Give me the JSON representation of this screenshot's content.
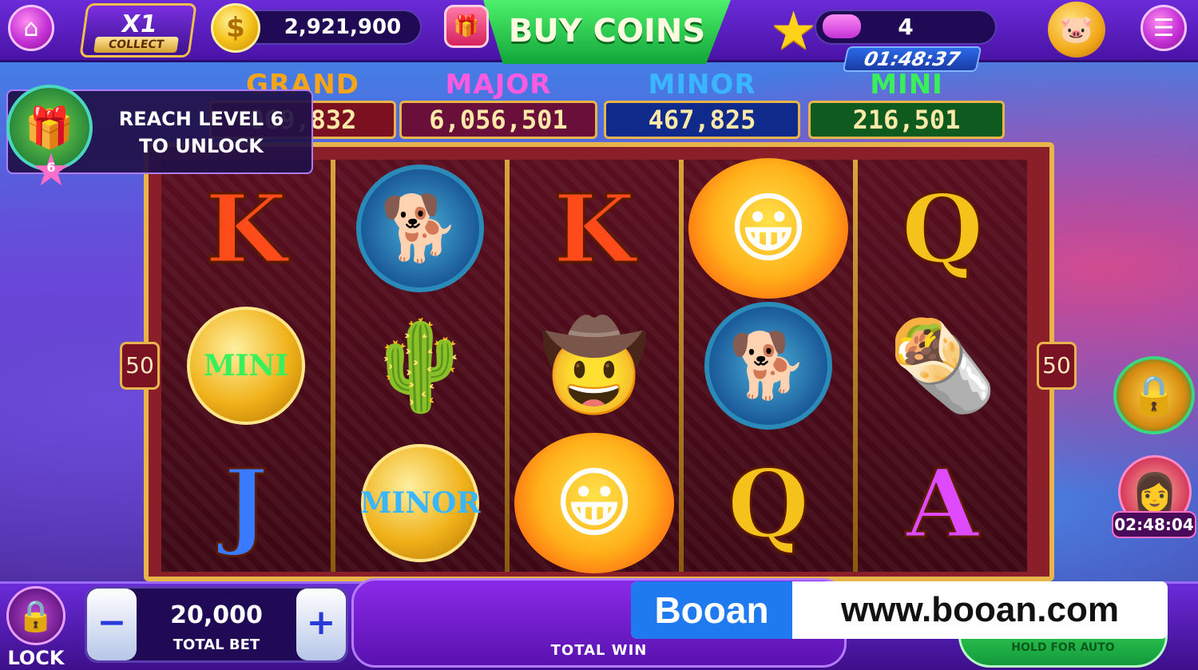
{
  "top_bar": {
    "home_icon": "home-icon",
    "collect": {
      "multiplier": "X1",
      "label": "COLLECT"
    },
    "balance": "2,921,900",
    "buy_coins_label": "BUY COINS",
    "level": "4",
    "level_timer": "01:48:37",
    "menu_icon": "menu-icon"
  },
  "jackpots": [
    {
      "title": "GRAND",
      "value": "069,832",
      "color": "#f4a51a",
      "bg": "#7a1020"
    },
    {
      "title": "MAJOR",
      "value": "6,056,501",
      "color": "#ff5ae0",
      "bg": "#6a0f3a"
    },
    {
      "title": "MINOR",
      "value": "467,825",
      "color": "#3ab6ff",
      "bg": "#0f2a8a"
    },
    {
      "title": "MINI",
      "value": "216,501",
      "color": "#3af05a",
      "bg": "#0f5a1f"
    }
  ],
  "unlock_popup": {
    "line1": "REACH LEVEL 6",
    "line2": "TO UNLOCK",
    "level_badge": "6"
  },
  "reels": [
    [
      {
        "kind": "letter",
        "text": "K",
        "color": "#ff4a1a"
      },
      {
        "kind": "coin",
        "text": "MINI",
        "color": "#3af05a"
      },
      {
        "kind": "letter",
        "text": "J",
        "color": "#3a7aff"
      }
    ],
    [
      {
        "kind": "badge",
        "text": "🐕"
      },
      {
        "kind": "emoji",
        "text": "🌵"
      },
      {
        "kind": "coin",
        "text": "MINOR",
        "color": "#3ab6ff"
      }
    ],
    [
      {
        "kind": "letter",
        "text": "K",
        "color": "#ff4a1a"
      },
      {
        "kind": "emoji",
        "text": "🤠"
      },
      {
        "kind": "sun",
        "text": "😀"
      }
    ],
    [
      {
        "kind": "sun",
        "text": "😀"
      },
      {
        "kind": "badge",
        "text": "🐕"
      },
      {
        "kind": "letter",
        "text": "Q",
        "color": "#f4c21a"
      }
    ],
    [
      {
        "kind": "letter",
        "text": "Q",
        "color": "#f4c21a"
      },
      {
        "kind": "emoji",
        "text": "🌯"
      },
      {
        "kind": "letter",
        "text": "A",
        "color": "#e04aff"
      }
    ]
  ],
  "side_markers": {
    "left": "50",
    "right": "50"
  },
  "side_offer": {
    "timer": "02:48:04"
  },
  "bottom_bar": {
    "lock_label": "LOCK",
    "minus": "−",
    "plus": "+",
    "bet_value": "20,000",
    "bet_label": "TOTAL BET",
    "total_win_label": "TOTAL WIN",
    "spin_sub": "HOLD FOR AUTO"
  },
  "watermark": {
    "brand": "Booan",
    "url": "www.booan.com"
  }
}
